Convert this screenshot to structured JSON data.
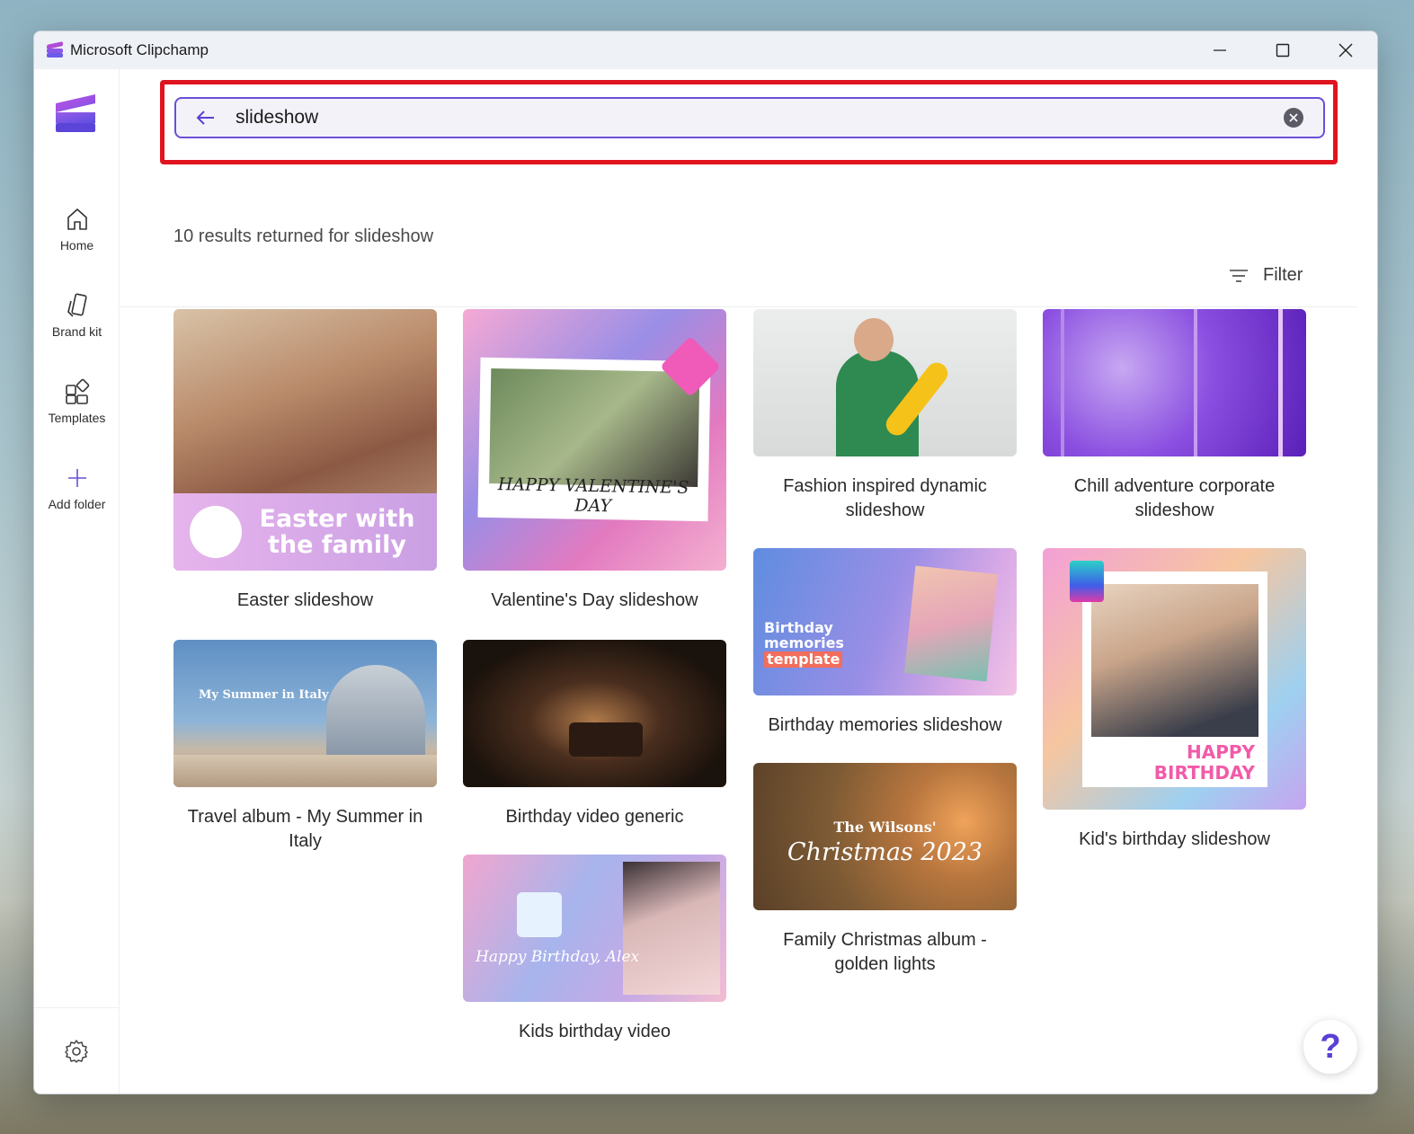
{
  "window": {
    "title": "Microsoft Clipchamp"
  },
  "sidebar": {
    "items": [
      {
        "label": "Home",
        "icon": "home-icon"
      },
      {
        "label": "Brand kit",
        "icon": "brand-kit-icon"
      },
      {
        "label": "Templates",
        "icon": "templates-icon"
      },
      {
        "label": "Add folder",
        "icon": "add-icon"
      }
    ],
    "settings_icon": "gear-icon"
  },
  "search": {
    "value": "slideshow",
    "back_icon": "arrow-left-icon",
    "clear_icon": "close-circle-icon"
  },
  "results": {
    "summary": "10 results returned for slideshow",
    "filter_label": "Filter"
  },
  "cards": [
    {
      "title": "Easter slideshow",
      "overlay": "Easter with the family"
    },
    {
      "title": "Valentine's Day slideshow",
      "overlay": "HAPPY VALENTINE'S DAY"
    },
    {
      "title": "Fashion inspired dynamic slideshow"
    },
    {
      "title": "Chill adventure corporate slideshow"
    },
    {
      "title": "Travel album - My Summer in Italy",
      "overlay": "My Summer in Italy"
    },
    {
      "title": "Birthday video generic"
    },
    {
      "title": "Birthday memories slideshow",
      "overlay_1": "Birthday",
      "overlay_2": "memories",
      "overlay_3": "template"
    },
    {
      "title": "Kid's birthday slideshow",
      "overlay_1": "HAPPY",
      "overlay_2": "BIRTHDAY"
    },
    {
      "title": "Family Christmas album - golden lights",
      "overlay_1": "The Wilsons'",
      "overlay_2": "Christmas 2023"
    },
    {
      "title": "Kids birthday video",
      "overlay": "Happy Birthday, Alex"
    }
  ],
  "help": {
    "label": "?"
  },
  "colors": {
    "accent": "#6b4fd8",
    "highlight": "#e0141e"
  }
}
